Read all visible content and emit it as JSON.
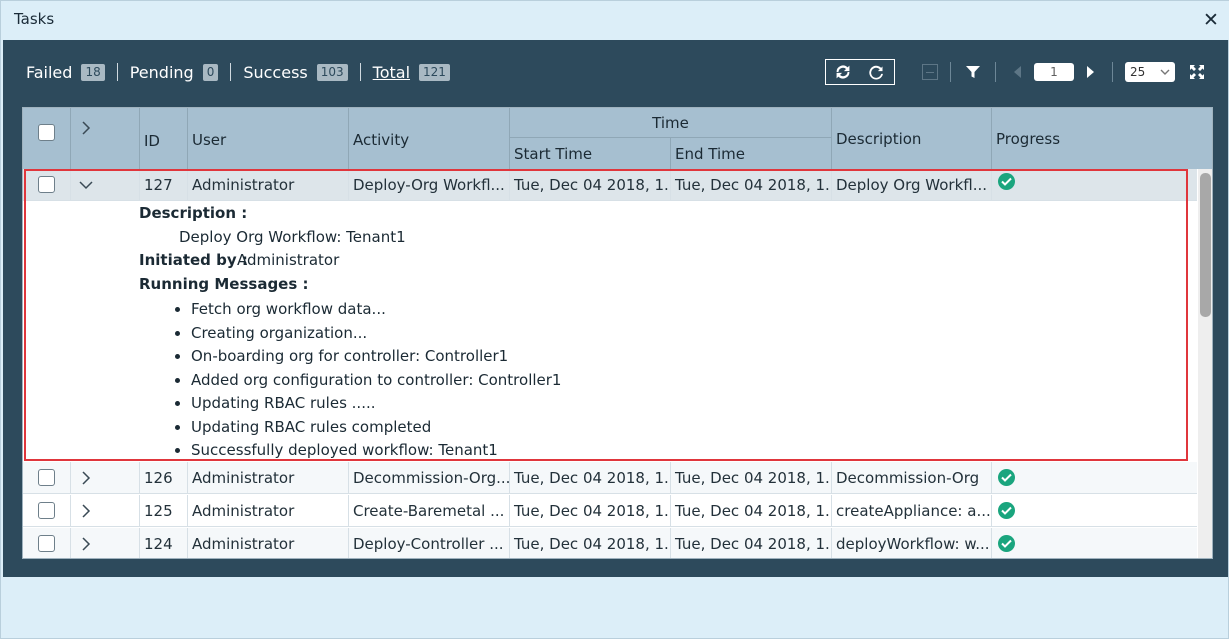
{
  "window": {
    "title": "Tasks",
    "close_glyph": "✕"
  },
  "status": {
    "failed_label": "Failed",
    "failed_count": "18",
    "pending_label": "Pending",
    "pending_count": "0",
    "success_label": "Success",
    "success_count": "103",
    "total_label": "Total",
    "total_count": "121"
  },
  "toolbar": {
    "page": "1",
    "per_page": "25",
    "icons": [
      "refresh-icon",
      "reload-icon",
      "minus-icon",
      "filter-icon",
      "prev-icon",
      "next-icon",
      "expand-icon"
    ]
  },
  "table": {
    "headers": {
      "id": "ID",
      "user": "User",
      "activity": "Activity",
      "time": "Time",
      "start": "Start Time",
      "end": "End Time",
      "description": "Description",
      "progress": "Progress"
    },
    "rows": [
      {
        "id": "127",
        "user": "Administrator",
        "activity": "Deploy-Org Workfl...",
        "start": "Tue, Dec 04 2018, 1...",
        "end": "Tue, Dec 04 2018, 1...",
        "description": "Deploy Org Workfl..."
      },
      {
        "id": "126",
        "user": "Administrator",
        "activity": "Decommission-Org...",
        "start": "Tue, Dec 04 2018, 1...",
        "end": "Tue, Dec 04 2018, 1...",
        "description": "Decommission-Org"
      },
      {
        "id": "125",
        "user": "Administrator",
        "activity": "Create-Baremetal ...",
        "start": "Tue, Dec 04 2018, 1...",
        "end": "Tue, Dec 04 2018, 1...",
        "description": "createAppliance: a..."
      },
      {
        "id": "124",
        "user": "Administrator",
        "activity": "Deploy-Controller ...",
        "start": "Tue, Dec 04 2018, 1...",
        "end": "Tue, Dec 04 2018, 1...",
        "description": "deployWorkflow: w..."
      }
    ]
  },
  "detail": {
    "description_label": "Description :",
    "description_value": "Deploy Org Workflow: Tenant1",
    "initiated_label": "Initiated by :",
    "initiated_value": "Administrator",
    "messages_label": "Running Messages :",
    "messages": [
      "Fetch org workflow data...",
      "Creating organization...",
      "On-boarding org for controller: Controller1",
      "Added org configuration to controller: Controller1",
      "Updating RBAC rules .....",
      "Updating RBAC rules completed",
      "Successfully deployed workflow: Tenant1"
    ]
  },
  "colors": {
    "panel": "#2d4a5c",
    "header": "#a6bfd0",
    "success": "#1aa57e",
    "highlight": "#e0363c"
  }
}
